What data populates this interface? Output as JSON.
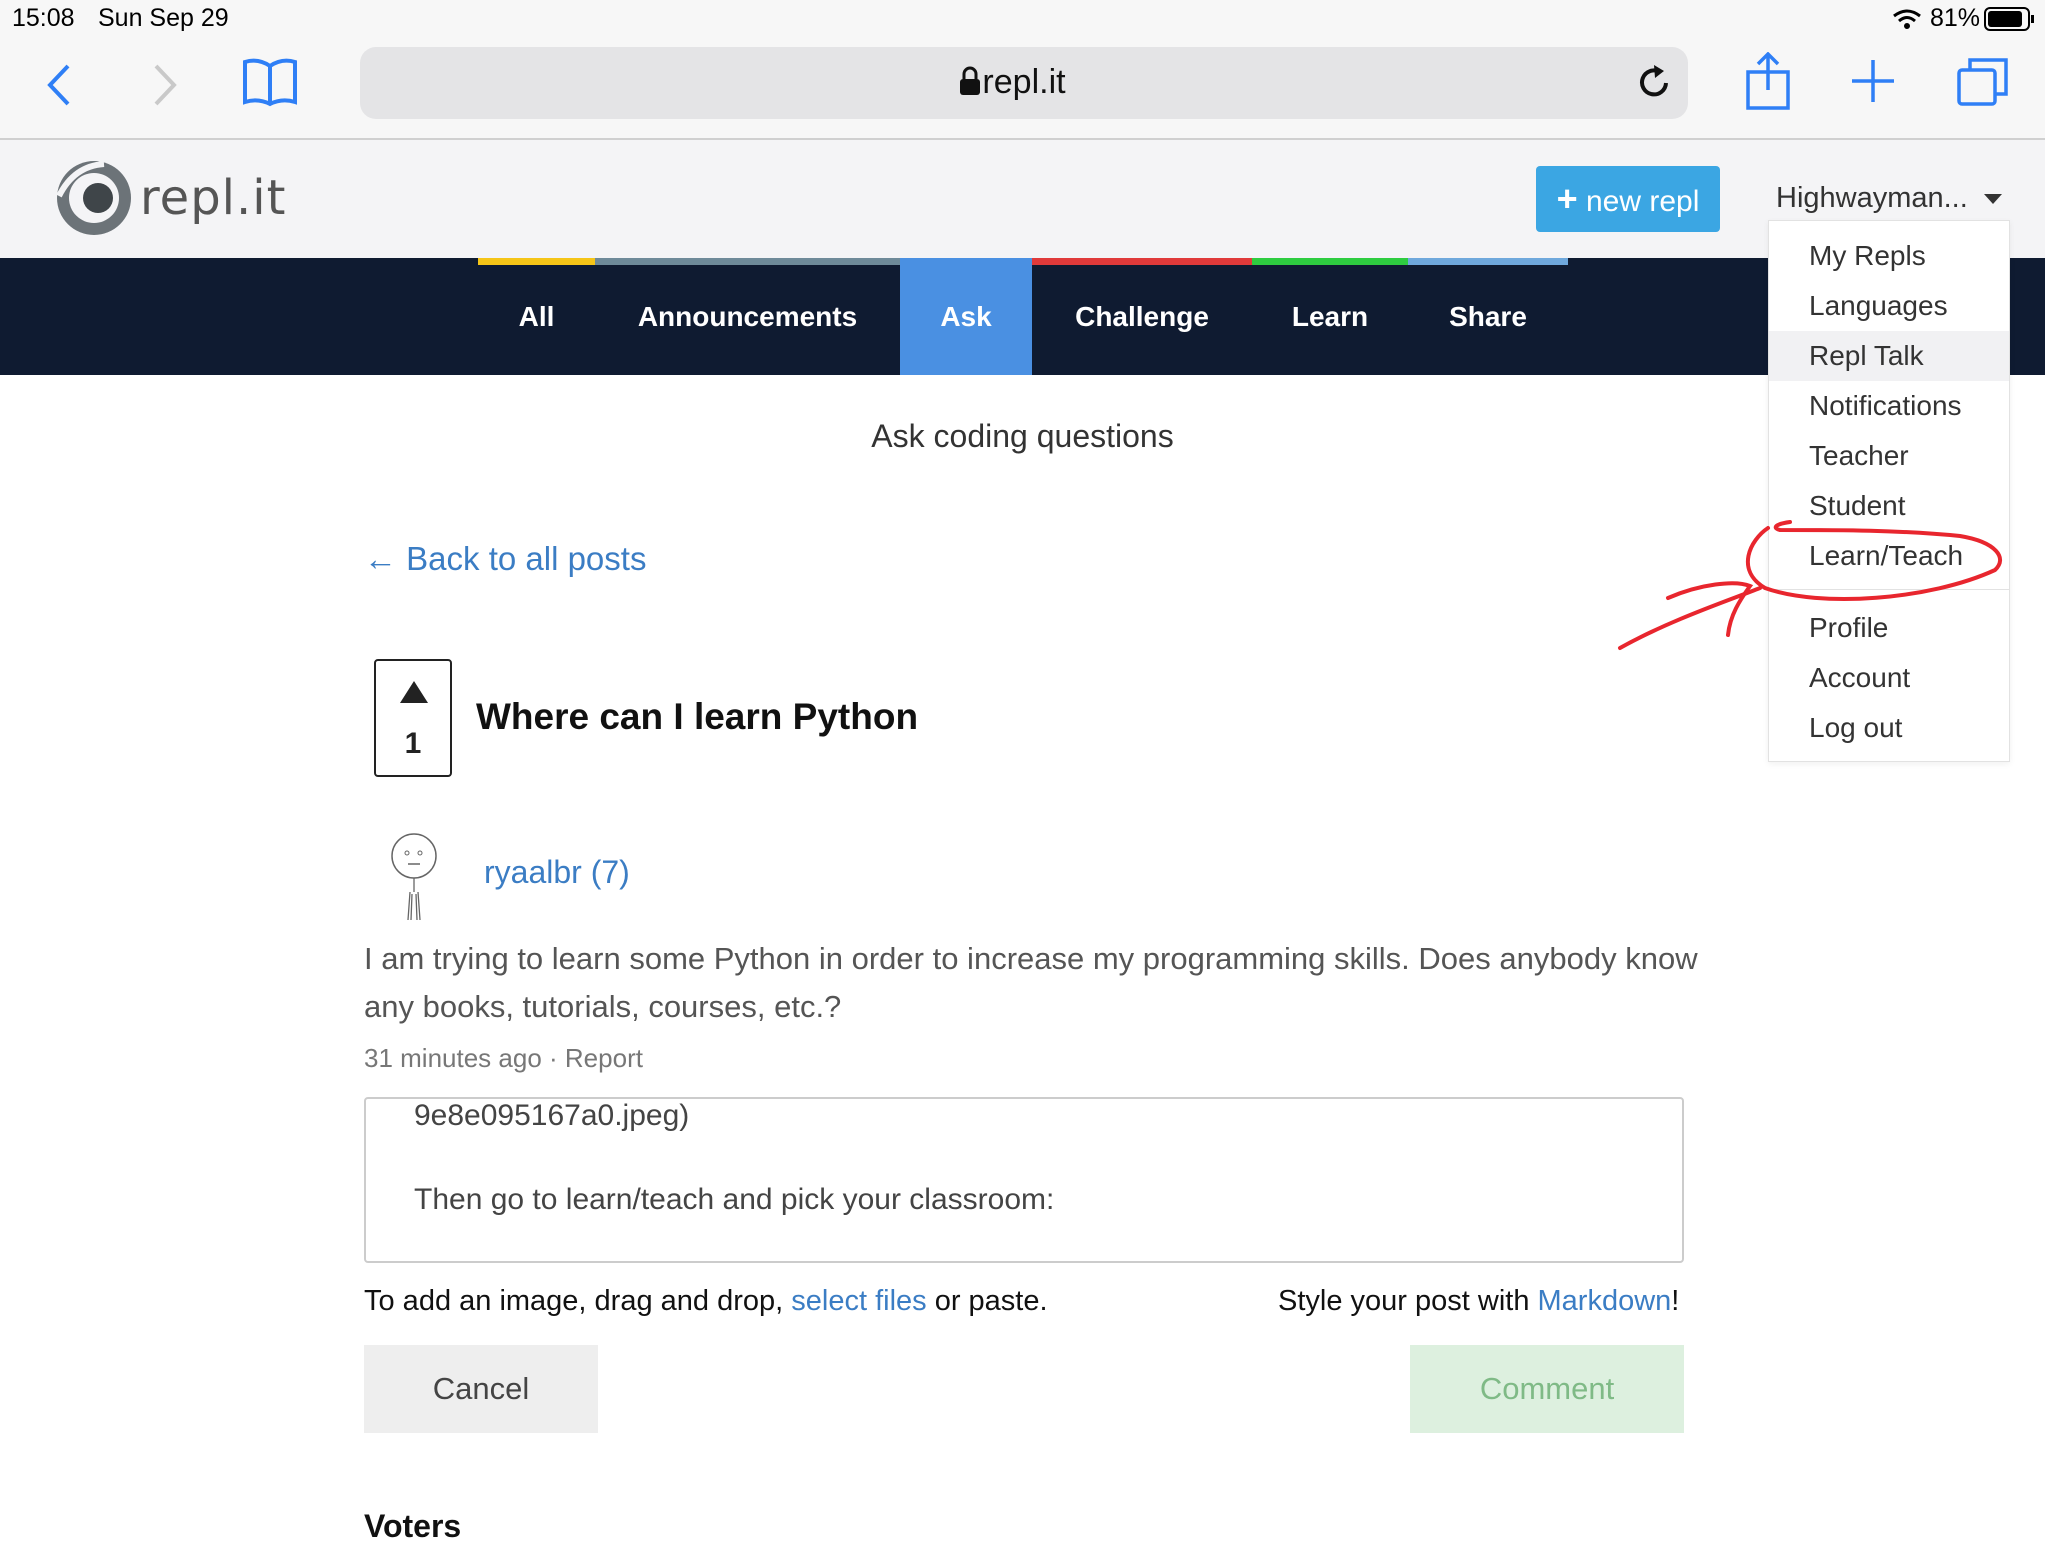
{
  "status_bar": {
    "time": "15:08",
    "date": "Sun Sep 29",
    "battery": "81%"
  },
  "browser": {
    "url": "repl.it"
  },
  "site_header": {
    "logo_text": "repl.it",
    "new_repl_label": "new repl",
    "user_label": "Highwayman..."
  },
  "nav": {
    "tabs": [
      {
        "label": "All",
        "color": "#f5c518"
      },
      {
        "label": "Announcements",
        "color": "#6e8a99"
      },
      {
        "label": "Ask",
        "color": "#4a90e2",
        "active": true
      },
      {
        "label": "Challenge",
        "color": "#e03a3a"
      },
      {
        "label": "Learn",
        "color": "#2ecc40"
      },
      {
        "label": "Share",
        "color": "#6fa8dc"
      }
    ]
  },
  "dropdown": {
    "items": [
      "My Repls",
      "Languages",
      "Repl Talk",
      "Notifications",
      "Teacher",
      "Student",
      "Learn/Teach",
      "Profile",
      "Account",
      "Log out"
    ]
  },
  "page": {
    "subtitle": "Ask coding questions",
    "back_link": "← Back to all posts",
    "vote_count": "1",
    "post_title": "Where can I learn Python",
    "author": "ryaalbr (7)",
    "body": "I am trying to learn some Python in order to increase my programming skills. Does anybody know any books, tutorials, courses, etc.?",
    "meta_time": "31 minutes ago",
    "meta_sep": " · ",
    "meta_report": "Report",
    "editor_line1": "9e8e095167a0.jpeg)",
    "editor_line2": "Then go to learn/teach and pick your classroom:",
    "hint_left_pre": "To add an image, drag and drop, ",
    "hint_left_link": "select files",
    "hint_left_post": " or paste.",
    "hint_right_pre": "Style your post with ",
    "hint_right_link": "Markdown",
    "hint_right_post": "!",
    "cancel_label": "Cancel",
    "comment_label": "Comment",
    "voters_heading": "Voters"
  },
  "annotation_color": "#e8262e"
}
